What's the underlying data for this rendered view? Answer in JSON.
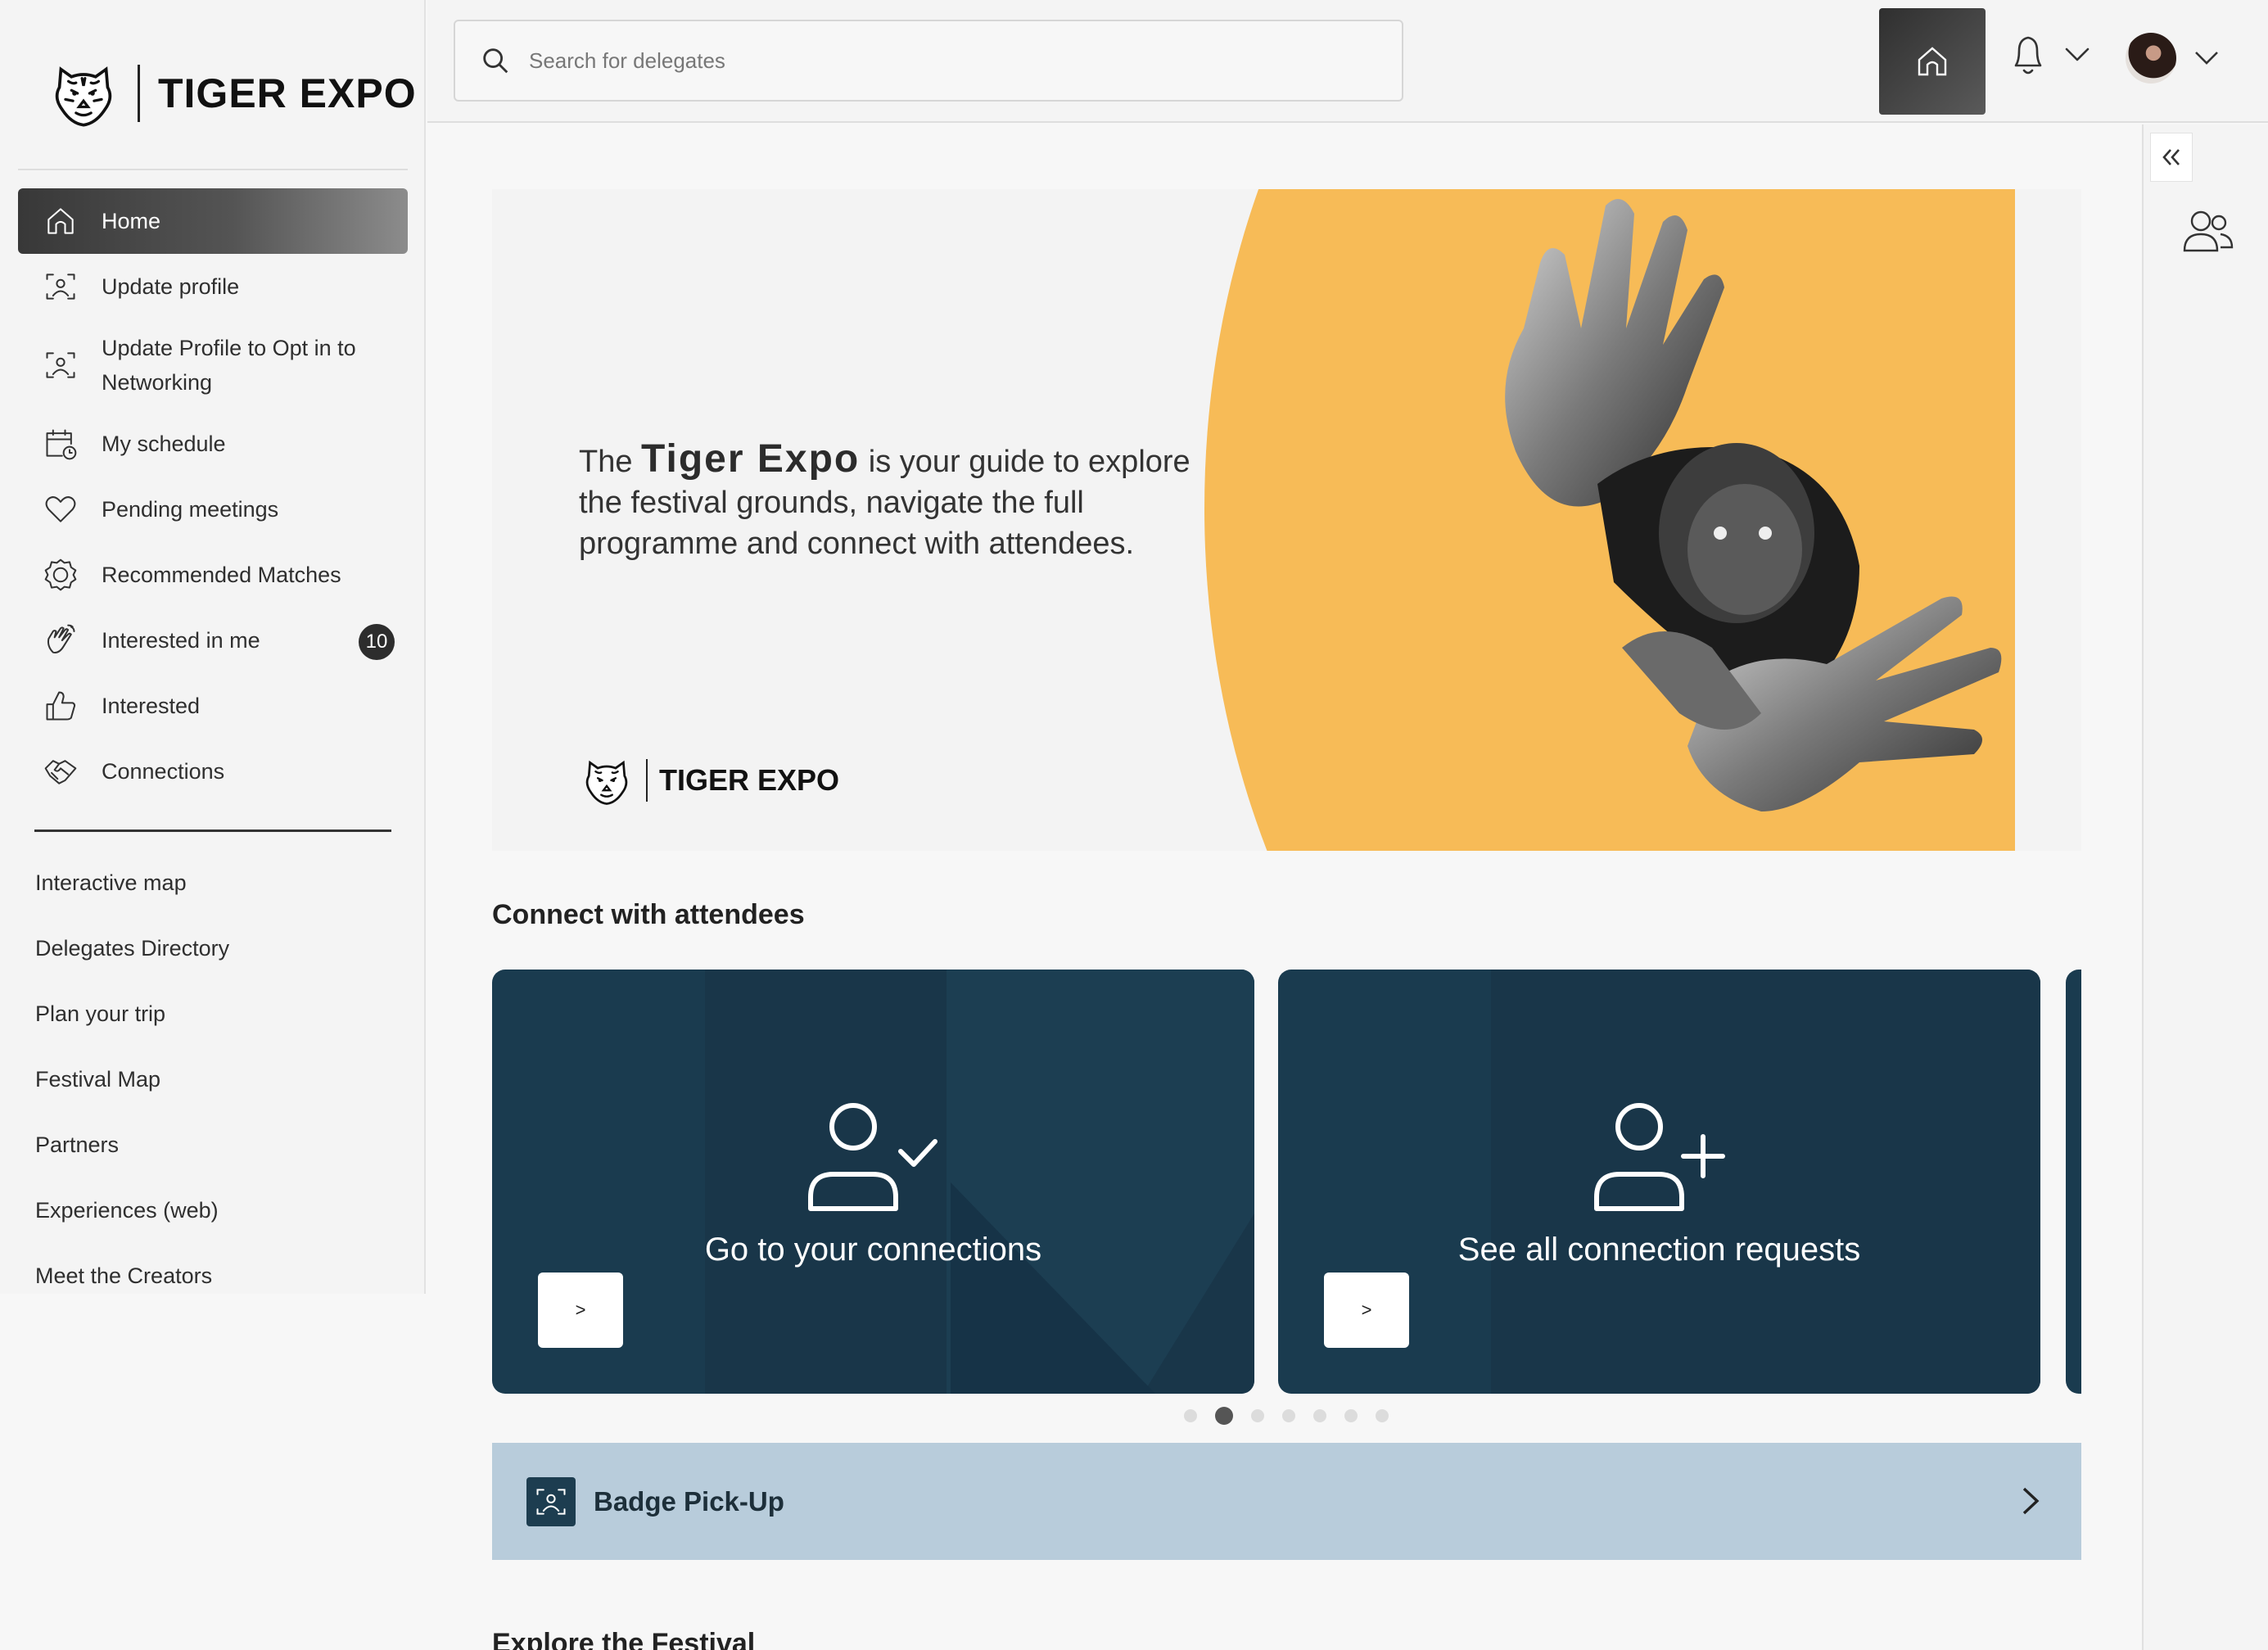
{
  "brand": {
    "name": "TIGER EXPO"
  },
  "sidebar": {
    "items": [
      {
        "label": "Home",
        "icon": "home-icon",
        "active": true
      },
      {
        "label": "Update profile",
        "icon": "face-scan-icon"
      },
      {
        "label": "Update Profile to Opt in to Networking",
        "icon": "face-scan-icon"
      },
      {
        "label": "My schedule",
        "icon": "calendar-clock-icon"
      },
      {
        "label": "Pending meetings",
        "icon": "heart-icon"
      },
      {
        "label": "Recommended Matches",
        "icon": "badge-icon"
      },
      {
        "label": "Interested in me",
        "icon": "wave-hand-icon",
        "count": "10"
      },
      {
        "label": "Interested",
        "icon": "thumbs-up-icon"
      },
      {
        "label": "Connections",
        "icon": "handshake-icon"
      }
    ],
    "links": [
      {
        "label": "Interactive map"
      },
      {
        "label": "Delegates Directory"
      },
      {
        "label": "Plan your trip"
      },
      {
        "label": "Festival Map"
      },
      {
        "label": "Partners"
      },
      {
        "label": "Experiences (web)"
      },
      {
        "label": "Meet the Creators"
      }
    ]
  },
  "search": {
    "placeholder": "Search for delegates",
    "value": ""
  },
  "hero": {
    "pre": "The",
    "brand": "Tiger Expo",
    "text": " is your guide to explore the festival grounds, navigate the full programme and connect with attendees.",
    "logo_text": "TIGER EXPO"
  },
  "connect": {
    "title": "Connect with attendees",
    "cards": [
      {
        "title": "Go to your connections",
        "button": ">",
        "icon": "user-check-icon"
      },
      {
        "title": "See all connection requests",
        "button": ">",
        "icon": "user-plus-icon"
      }
    ],
    "dots_total": 7,
    "dots_active": 2
  },
  "badge_pickup": {
    "label": "Badge Pick-Up",
    "icon": "face-scan-icon"
  },
  "explore": {
    "title": "Explore the Festival"
  },
  "colors": {
    "accent": "#f7bb57",
    "card": "#1a3b4f",
    "badge_bar": "#b8ccdb",
    "active_nav": "#3a3a3a"
  }
}
